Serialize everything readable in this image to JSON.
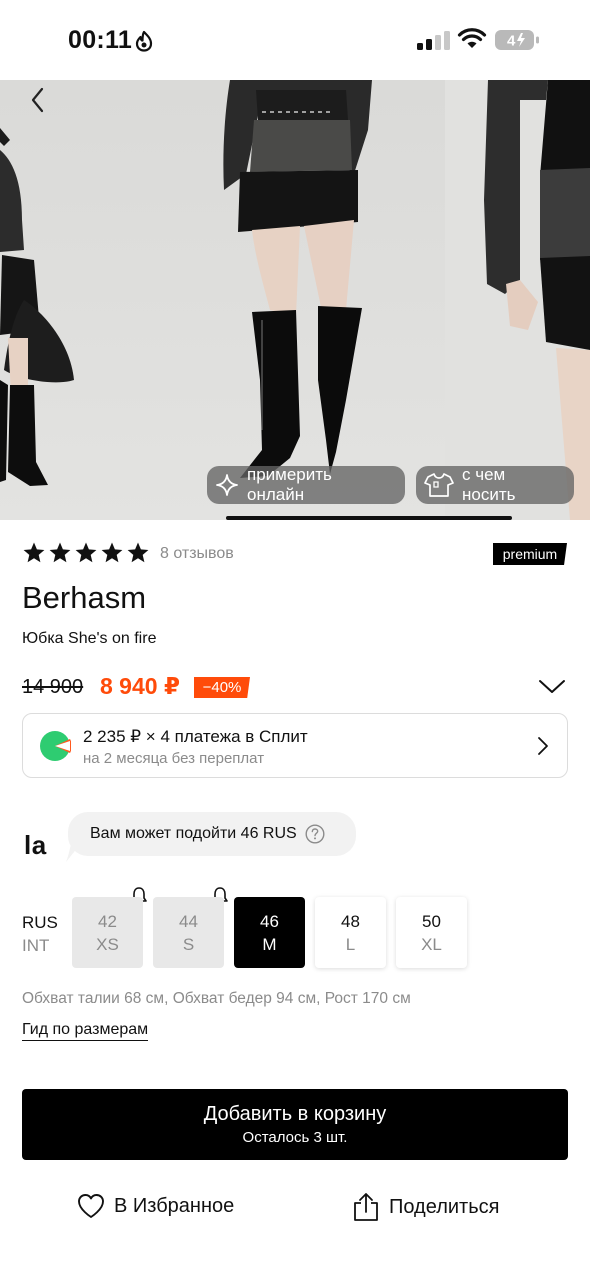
{
  "status_bar": {
    "time": "00:11",
    "battery_level": "4"
  },
  "gallery": {
    "try_online_label": "примерить онлайн",
    "what_to_wear_label": "с чем носить"
  },
  "rating": {
    "stars": 5,
    "reviews_label": "8 отзывов",
    "badge": "premium"
  },
  "product": {
    "brand": "Berhasm",
    "name": "Юбка She's on fire",
    "old_price": "14 900",
    "new_price": "8 940 ₽",
    "discount": "−40%"
  },
  "split": {
    "title": "2 235 ₽ × 4 платежа в Сплит",
    "subtitle": "на 2 месяца без переплат"
  },
  "fit_hint": {
    "logo": "la",
    "text": "Вам может подойти 46 RUS"
  },
  "sizes": {
    "row_labels": {
      "rus": "RUS",
      "int": "INT"
    },
    "items": [
      {
        "rus": "42",
        "int": "XS",
        "state": "unavailable"
      },
      {
        "rus": "44",
        "int": "S",
        "state": "unavailable"
      },
      {
        "rus": "46",
        "int": "M",
        "state": "selected"
      },
      {
        "rus": "48",
        "int": "L",
        "state": "available"
      },
      {
        "rus": "50",
        "int": "XL",
        "state": "available"
      }
    ],
    "measurements": "Обхват талии 68 см, Обхват бедер 94 см, Рост 170 см",
    "guide_link": "Гид по размерам"
  },
  "cart": {
    "label": "Добавить в корзину",
    "stock": "Осталось 3 шт."
  },
  "actions": {
    "favorite_label": "В Избранное",
    "share_label": "Поделиться"
  },
  "colors": {
    "accent": "#ff4b0a",
    "primary": "#000000",
    "muted_text": "#8b8b8b"
  }
}
